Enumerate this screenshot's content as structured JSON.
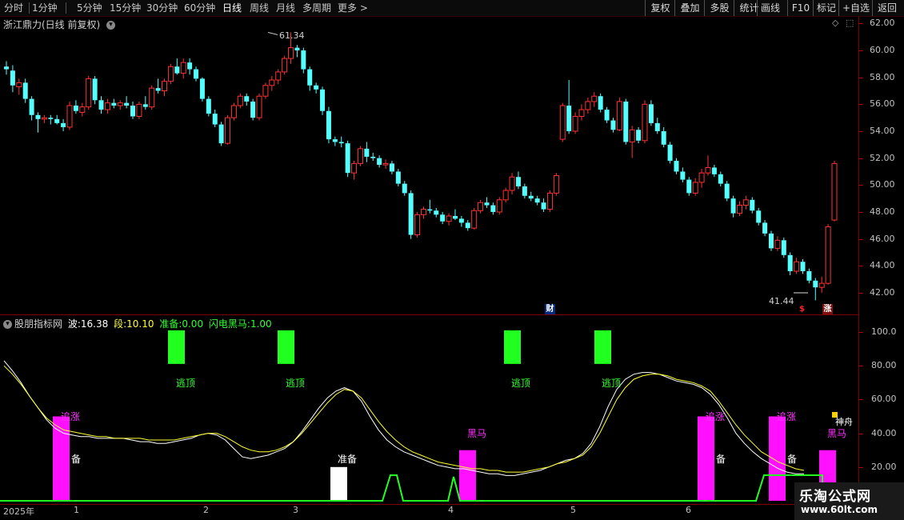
{
  "toolbar": {
    "periods": [
      "分时",
      "1分钟",
      "5分钟",
      "15分钟",
      "30分钟",
      "60分钟",
      "日线",
      "周线",
      "月线",
      "多周期",
      "更多 >"
    ],
    "active_period": "日线",
    "right_buttons": [
      "复权",
      "叠加",
      "多股",
      "统计",
      "画线",
      "F10",
      "标记",
      "+自选",
      "返回"
    ]
  },
  "main_chart": {
    "title": "浙江鼎力(日线 前复权)",
    "high_label": "61.34",
    "low_label": "41.44",
    "y_ticks": [
      "62.00",
      "60.00",
      "58.00",
      "56.00",
      "54.00",
      "52.00",
      "50.00",
      "48.00",
      "46.00",
      "44.00",
      "42.00"
    ],
    "marker_cai": "财",
    "marker_s": "$",
    "marker_zhang": "涨",
    "up_color": "#ff3232",
    "down_color": "#54ffff"
  },
  "indicator": {
    "name": "股朋指标网",
    "wave_label": "波:",
    "wave_value": "16.38",
    "seg_label": "段:",
    "seg_value": "10.10",
    "prep_label": "准备:",
    "prep_value": "0.00",
    "flash_label": "闪电黑马:",
    "flash_value": "1.00",
    "y_ticks": [
      "100.0",
      "80.00",
      "60.00",
      "40.00",
      "20.00"
    ],
    "signals": {
      "escape": "逃顶",
      "chase": "追涨",
      "prepare": "准备",
      "prepare_short": "备",
      "darkhorse": "黑马",
      "shenzhou": "神舟"
    }
  },
  "x_axis": [
    "2025年",
    "1",
    "2",
    "3",
    "4",
    "5",
    "6"
  ],
  "watermark": {
    "site": "乐淘公式网",
    "url": "www.60lt.com"
  },
  "chart_data": [
    {
      "type": "candlestick",
      "title": "浙江鼎力(日线 前复权)",
      "ylim": [
        41,
        63
      ],
      "annotations": {
        "high": 61.34,
        "low": 41.44
      },
      "candles": [
        {
          "o": 58.8,
          "h": 59.2,
          "l": 58.2,
          "c": 58.6
        },
        {
          "o": 58.5,
          "h": 58.9,
          "l": 56.9,
          "c": 57.4
        },
        {
          "o": 57.3,
          "h": 57.9,
          "l": 56.7,
          "c": 57.6
        },
        {
          "o": 57.6,
          "h": 57.9,
          "l": 56.1,
          "c": 56.4
        },
        {
          "o": 56.4,
          "h": 56.6,
          "l": 54.8,
          "c": 55.2
        },
        {
          "o": 55.2,
          "h": 55.4,
          "l": 53.9,
          "c": 54.9
        },
        {
          "o": 54.9,
          "h": 55.2,
          "l": 54.6,
          "c": 55.0
        },
        {
          "o": 55.0,
          "h": 55.2,
          "l": 54.5,
          "c": 54.9
        },
        {
          "o": 54.9,
          "h": 55.2,
          "l": 54.5,
          "c": 54.6
        },
        {
          "o": 54.6,
          "h": 54.9,
          "l": 54.0,
          "c": 54.3
        },
        {
          "o": 54.3,
          "h": 56.2,
          "l": 54.1,
          "c": 55.9
        },
        {
          "o": 55.9,
          "h": 56.3,
          "l": 55.3,
          "c": 55.5
        },
        {
          "o": 55.4,
          "h": 56.1,
          "l": 55.1,
          "c": 55.8
        },
        {
          "o": 55.8,
          "h": 58.1,
          "l": 55.6,
          "c": 57.9
        },
        {
          "o": 57.9,
          "h": 58.1,
          "l": 56.0,
          "c": 56.3
        },
        {
          "o": 56.3,
          "h": 56.6,
          "l": 55.3,
          "c": 55.6
        },
        {
          "o": 55.6,
          "h": 56.4,
          "l": 55.3,
          "c": 56.1
        },
        {
          "o": 56.1,
          "h": 56.4,
          "l": 55.7,
          "c": 55.9
        },
        {
          "o": 55.9,
          "h": 56.3,
          "l": 55.6,
          "c": 56.1
        },
        {
          "o": 56.1,
          "h": 56.6,
          "l": 55.7,
          "c": 55.9
        },
        {
          "o": 55.9,
          "h": 56.2,
          "l": 54.9,
          "c": 55.1
        },
        {
          "o": 55.1,
          "h": 56.2,
          "l": 54.9,
          "c": 56.0
        },
        {
          "o": 56.0,
          "h": 56.6,
          "l": 55.6,
          "c": 55.8
        },
        {
          "o": 55.8,
          "h": 57.4,
          "l": 55.6,
          "c": 57.2
        },
        {
          "o": 57.2,
          "h": 57.9,
          "l": 56.8,
          "c": 57.0
        },
        {
          "o": 57.0,
          "h": 57.9,
          "l": 56.6,
          "c": 57.7
        },
        {
          "o": 57.7,
          "h": 59.0,
          "l": 57.5,
          "c": 58.8
        },
        {
          "o": 58.8,
          "h": 59.4,
          "l": 58.2,
          "c": 58.3
        },
        {
          "o": 58.3,
          "h": 59.4,
          "l": 57.9,
          "c": 59.1
        },
        {
          "o": 59.1,
          "h": 59.4,
          "l": 58.2,
          "c": 58.6
        },
        {
          "o": 58.6,
          "h": 58.8,
          "l": 57.7,
          "c": 57.9
        },
        {
          "o": 57.9,
          "h": 58.0,
          "l": 56.2,
          "c": 56.4
        },
        {
          "o": 56.4,
          "h": 56.6,
          "l": 55.1,
          "c": 55.3
        },
        {
          "o": 55.3,
          "h": 55.6,
          "l": 54.3,
          "c": 54.5
        },
        {
          "o": 54.5,
          "h": 54.7,
          "l": 52.9,
          "c": 53.1
        },
        {
          "o": 53.1,
          "h": 55.2,
          "l": 53.0,
          "c": 55.0
        },
        {
          "o": 55.0,
          "h": 56.1,
          "l": 54.8,
          "c": 55.9
        },
        {
          "o": 55.9,
          "h": 56.8,
          "l": 55.7,
          "c": 56.6
        },
        {
          "o": 56.6,
          "h": 56.8,
          "l": 55.9,
          "c": 56.2
        },
        {
          "o": 56.2,
          "h": 56.4,
          "l": 54.8,
          "c": 55.0
        },
        {
          "o": 55.0,
          "h": 56.8,
          "l": 54.8,
          "c": 56.6
        },
        {
          "o": 56.6,
          "h": 57.6,
          "l": 56.4,
          "c": 57.4
        },
        {
          "o": 57.4,
          "h": 58.1,
          "l": 57.0,
          "c": 57.8
        },
        {
          "o": 57.8,
          "h": 58.6,
          "l": 57.5,
          "c": 58.4
        },
        {
          "o": 58.4,
          "h": 59.6,
          "l": 58.2,
          "c": 59.4
        },
        {
          "o": 59.4,
          "h": 61.34,
          "l": 59.0,
          "c": 60.2
        },
        {
          "o": 60.2,
          "h": 60.4,
          "l": 59.5,
          "c": 60.0
        },
        {
          "o": 60.0,
          "h": 60.2,
          "l": 58.3,
          "c": 58.6
        },
        {
          "o": 58.6,
          "h": 58.8,
          "l": 57.0,
          "c": 57.4
        },
        {
          "o": 57.4,
          "h": 57.6,
          "l": 56.8,
          "c": 57.1
        },
        {
          "o": 57.1,
          "h": 57.3,
          "l": 55.2,
          "c": 55.5
        },
        {
          "o": 55.5,
          "h": 55.8,
          "l": 53.1,
          "c": 53.4
        },
        {
          "o": 53.4,
          "h": 53.6,
          "l": 52.9,
          "c": 53.2
        },
        {
          "o": 53.2,
          "h": 53.6,
          "l": 52.8,
          "c": 53.1
        },
        {
          "o": 53.1,
          "h": 53.3,
          "l": 50.6,
          "c": 50.9
        },
        {
          "o": 50.9,
          "h": 51.8,
          "l": 50.4,
          "c": 51.6
        },
        {
          "o": 51.6,
          "h": 52.9,
          "l": 51.4,
          "c": 52.7
        },
        {
          "o": 52.7,
          "h": 53.2,
          "l": 51.7,
          "c": 52.1
        },
        {
          "o": 52.1,
          "h": 52.4,
          "l": 51.8,
          "c": 52.0
        },
        {
          "o": 52.0,
          "h": 52.2,
          "l": 51.3,
          "c": 51.5
        },
        {
          "o": 51.5,
          "h": 51.9,
          "l": 51.2,
          "c": 51.6
        },
        {
          "o": 51.6,
          "h": 51.8,
          "l": 50.8,
          "c": 51.0
        },
        {
          "o": 51.0,
          "h": 51.2,
          "l": 49.9,
          "c": 50.1
        },
        {
          "o": 50.1,
          "h": 50.3,
          "l": 49.2,
          "c": 49.4
        },
        {
          "o": 49.4,
          "h": 49.6,
          "l": 46.0,
          "c": 46.3
        },
        {
          "o": 46.3,
          "h": 48.0,
          "l": 46.1,
          "c": 47.8
        },
        {
          "o": 47.8,
          "h": 48.4,
          "l": 47.5,
          "c": 48.2
        },
        {
          "o": 48.2,
          "h": 48.9,
          "l": 47.9,
          "c": 48.1
        },
        {
          "o": 48.1,
          "h": 48.3,
          "l": 47.6,
          "c": 47.8
        },
        {
          "o": 47.8,
          "h": 48.0,
          "l": 47.1,
          "c": 47.3
        },
        {
          "o": 47.3,
          "h": 47.9,
          "l": 47.0,
          "c": 47.7
        },
        {
          "o": 47.7,
          "h": 48.2,
          "l": 47.4,
          "c": 47.5
        },
        {
          "o": 47.5,
          "h": 47.7,
          "l": 46.9,
          "c": 47.2
        },
        {
          "o": 47.2,
          "h": 47.4,
          "l": 46.6,
          "c": 46.8
        },
        {
          "o": 46.8,
          "h": 48.3,
          "l": 46.7,
          "c": 48.1
        },
        {
          "o": 48.1,
          "h": 48.9,
          "l": 47.9,
          "c": 48.7
        },
        {
          "o": 48.7,
          "h": 49.1,
          "l": 48.3,
          "c": 48.5
        },
        {
          "o": 48.5,
          "h": 48.7,
          "l": 47.8,
          "c": 48.0
        },
        {
          "o": 48.0,
          "h": 49.1,
          "l": 47.8,
          "c": 48.9
        },
        {
          "o": 48.9,
          "h": 49.8,
          "l": 48.7,
          "c": 49.6
        },
        {
          "o": 49.6,
          "h": 50.9,
          "l": 49.3,
          "c": 50.6
        },
        {
          "o": 50.6,
          "h": 51.0,
          "l": 49.7,
          "c": 49.9
        },
        {
          "o": 49.9,
          "h": 50.1,
          "l": 49.0,
          "c": 49.2
        },
        {
          "o": 49.2,
          "h": 49.5,
          "l": 48.8,
          "c": 49.0
        },
        {
          "o": 49.0,
          "h": 49.2,
          "l": 48.5,
          "c": 48.7
        },
        {
          "o": 48.7,
          "h": 49.0,
          "l": 48.0,
          "c": 48.2
        },
        {
          "o": 48.2,
          "h": 49.6,
          "l": 48.0,
          "c": 49.4
        },
        {
          "o": 49.4,
          "h": 50.9,
          "l": 49.2,
          "c": 50.7
        },
        {
          "o": 53.4,
          "h": 56.1,
          "l": 53.2,
          "c": 55.9
        },
        {
          "o": 55.9,
          "h": 57.8,
          "l": 53.8,
          "c": 54.0
        },
        {
          "o": 54.0,
          "h": 55.4,
          "l": 53.8,
          "c": 55.1
        },
        {
          "o": 55.1,
          "h": 56.0,
          "l": 54.8,
          "c": 55.6
        },
        {
          "o": 55.6,
          "h": 56.5,
          "l": 55.3,
          "c": 56.2
        },
        {
          "o": 56.2,
          "h": 56.9,
          "l": 55.8,
          "c": 56.6
        },
        {
          "o": 56.6,
          "h": 56.8,
          "l": 55.4,
          "c": 55.6
        },
        {
          "o": 55.6,
          "h": 55.8,
          "l": 54.6,
          "c": 54.8
        },
        {
          "o": 54.8,
          "h": 55.0,
          "l": 53.9,
          "c": 54.1
        },
        {
          "o": 54.1,
          "h": 56.5,
          "l": 54.0,
          "c": 56.2
        },
        {
          "o": 56.2,
          "h": 56.4,
          "l": 53.0,
          "c": 53.2
        },
        {
          "o": 53.2,
          "h": 54.4,
          "l": 52.0,
          "c": 54.1
        },
        {
          "o": 54.1,
          "h": 54.3,
          "l": 53.1,
          "c": 53.3
        },
        {
          "o": 53.3,
          "h": 56.3,
          "l": 53.1,
          "c": 56.0
        },
        {
          "o": 56.0,
          "h": 56.3,
          "l": 54.4,
          "c": 54.6
        },
        {
          "o": 54.6,
          "h": 55.0,
          "l": 53.8,
          "c": 54.0
        },
        {
          "o": 54.0,
          "h": 54.3,
          "l": 52.8,
          "c": 53.0
        },
        {
          "o": 53.0,
          "h": 53.2,
          "l": 51.6,
          "c": 51.8
        },
        {
          "o": 51.8,
          "h": 52.0,
          "l": 50.8,
          "c": 51.0
        },
        {
          "o": 51.0,
          "h": 51.3,
          "l": 50.2,
          "c": 50.4
        },
        {
          "o": 50.4,
          "h": 50.6,
          "l": 49.2,
          "c": 49.4
        },
        {
          "o": 49.4,
          "h": 50.5,
          "l": 49.2,
          "c": 50.2
        },
        {
          "o": 50.2,
          "h": 51.2,
          "l": 49.8,
          "c": 50.9
        },
        {
          "o": 50.9,
          "h": 52.2,
          "l": 50.7,
          "c": 51.3
        },
        {
          "o": 51.3,
          "h": 51.5,
          "l": 50.6,
          "c": 50.8
        },
        {
          "o": 50.8,
          "h": 51.0,
          "l": 49.9,
          "c": 50.1
        },
        {
          "o": 50.1,
          "h": 50.3,
          "l": 48.8,
          "c": 49.0
        },
        {
          "o": 49.0,
          "h": 49.2,
          "l": 47.6,
          "c": 47.9
        },
        {
          "o": 47.9,
          "h": 48.8,
          "l": 47.7,
          "c": 48.5
        },
        {
          "o": 48.5,
          "h": 49.2,
          "l": 48.2,
          "c": 48.9
        },
        {
          "o": 48.9,
          "h": 49.1,
          "l": 47.9,
          "c": 48.1
        },
        {
          "o": 48.1,
          "h": 48.3,
          "l": 47.0,
          "c": 47.2
        },
        {
          "o": 47.2,
          "h": 47.4,
          "l": 46.2,
          "c": 46.4
        },
        {
          "o": 46.4,
          "h": 46.6,
          "l": 45.1,
          "c": 45.3
        },
        {
          "o": 45.3,
          "h": 46.2,
          "l": 45.1,
          "c": 45.9
        },
        {
          "o": 45.9,
          "h": 46.1,
          "l": 44.6,
          "c": 44.8
        },
        {
          "o": 44.8,
          "h": 45.0,
          "l": 43.3,
          "c": 43.6
        },
        {
          "o": 43.6,
          "h": 44.6,
          "l": 43.4,
          "c": 44.3
        },
        {
          "o": 44.3,
          "h": 44.5,
          "l": 43.4,
          "c": 43.6
        },
        {
          "o": 43.6,
          "h": 43.8,
          "l": 42.7,
          "c": 42.9
        },
        {
          "o": 42.9,
          "h": 43.1,
          "l": 41.44,
          "c": 42.4
        },
        {
          "o": 42.4,
          "h": 43.2,
          "l": 42.0,
          "c": 42.7
        },
        {
          "o": 42.7,
          "h": 47.1,
          "l": 42.6,
          "c": 46.9
        },
        {
          "o": 47.4,
          "h": 51.8,
          "l": 47.3,
          "c": 51.6
        }
      ]
    },
    {
      "type": "line",
      "title": "股朋指标网",
      "ylim": [
        0,
        110
      ],
      "series": [
        {
          "name": "波",
          "values": [
            83,
            77,
            70,
            62,
            55,
            48,
            43,
            40,
            39,
            38,
            38,
            37,
            37,
            37,
            37,
            36,
            35,
            35,
            34,
            34,
            35,
            36,
            37,
            39,
            40,
            39,
            36,
            31,
            26,
            25,
            26,
            27,
            29,
            31,
            35,
            41,
            48,
            55,
            61,
            65,
            67,
            65,
            59,
            50,
            42,
            36,
            32,
            29,
            27,
            25,
            23,
            21,
            20,
            19,
            19,
            18,
            17,
            16,
            16,
            15,
            15,
            16,
            17,
            18,
            20,
            22,
            24,
            25,
            28,
            34,
            44,
            56,
            66,
            72,
            75,
            76,
            76,
            75,
            73,
            71,
            70,
            69,
            67,
            63,
            57,
            49,
            40,
            34,
            29,
            25,
            22,
            19,
            17,
            16,
            16
          ]
        },
        {
          "name": "段",
          "values": [
            80,
            75,
            69,
            62,
            55,
            49,
            45,
            42,
            41,
            40,
            39,
            38,
            38,
            37,
            37,
            37,
            37,
            36,
            36,
            36,
            36,
            37,
            38,
            39,
            40,
            40,
            38,
            35,
            32,
            30,
            29,
            29,
            30,
            32,
            35,
            40,
            46,
            52,
            58,
            63,
            66,
            65,
            61,
            54,
            47,
            41,
            36,
            32,
            29,
            27,
            25,
            23,
            22,
            21,
            20,
            19,
            19,
            18,
            18,
            17,
            17,
            17,
            18,
            19,
            20,
            22,
            23,
            25,
            27,
            32,
            40,
            50,
            60,
            67,
            72,
            74,
            75,
            75,
            74,
            72,
            71,
            70,
            68,
            65,
            59,
            52,
            45,
            39,
            34,
            29,
            26,
            23,
            21,
            19,
            18
          ]
        }
      ],
      "bars": {
        "逃顶": [
          80,
          80,
          80,
          80
        ],
        "追涨": [
          50,
          50,
          50
        ],
        "黑马": [
          30,
          30
        ],
        "准备": [
          20
        ]
      }
    }
  ]
}
